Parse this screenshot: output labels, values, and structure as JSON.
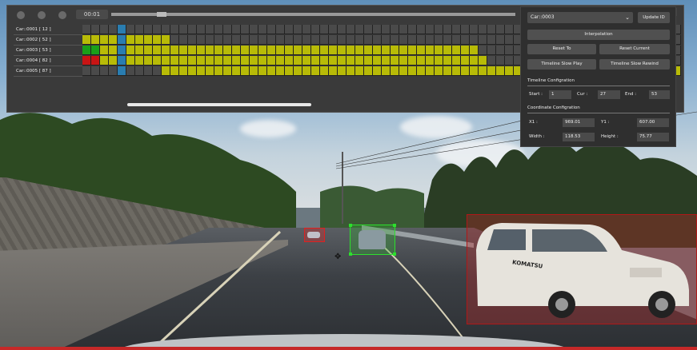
{
  "timeline": {
    "time": "00:01",
    "tracks": [
      {
        "label": "Car::0001 [ 12 ]"
      },
      {
        "label": "Car::0002 [ 52 ]"
      },
      {
        "label": "Car::0003 [ 53 ]"
      },
      {
        "label": "Car::0004 [ 82 ]"
      },
      {
        "label": "Car::0005 [ 87 ]"
      }
    ],
    "colors": {
      "filled": "#b8bb07",
      "current": "#19a019",
      "selected": "#c81414",
      "cursor": "#2a7db0",
      "empty": "#4a4a4a"
    }
  },
  "controls": {
    "object_select": "Car::0003",
    "update_id": "Update ID",
    "interpolation": "Interpolation",
    "reset_to": "Reset To",
    "reset_current": "Reset Current",
    "slow_play": "Timeline Slow Play",
    "slow_rewind": "Timeline Slow Rewind",
    "timeline_section": "Timeline Configration",
    "start_label": "Start :",
    "start_value": "1",
    "cur_label": "Cur :",
    "cur_value": "27",
    "end_label": "End :",
    "end_value": "53",
    "coord_section": "Coordinate Configration",
    "x1_label": "X1 :",
    "x1_value": "969.01",
    "y1_label": "Y1 :",
    "y1_value": "607.00",
    "width_label": "Width :",
    "width_value": "118.53",
    "height_label": "Height :",
    "height_value": "75.77"
  },
  "scene": {
    "van_text": "KOMATSU",
    "box_colors": {
      "van": "#c62020",
      "green": "#2de02d",
      "red": "#e02020"
    }
  }
}
